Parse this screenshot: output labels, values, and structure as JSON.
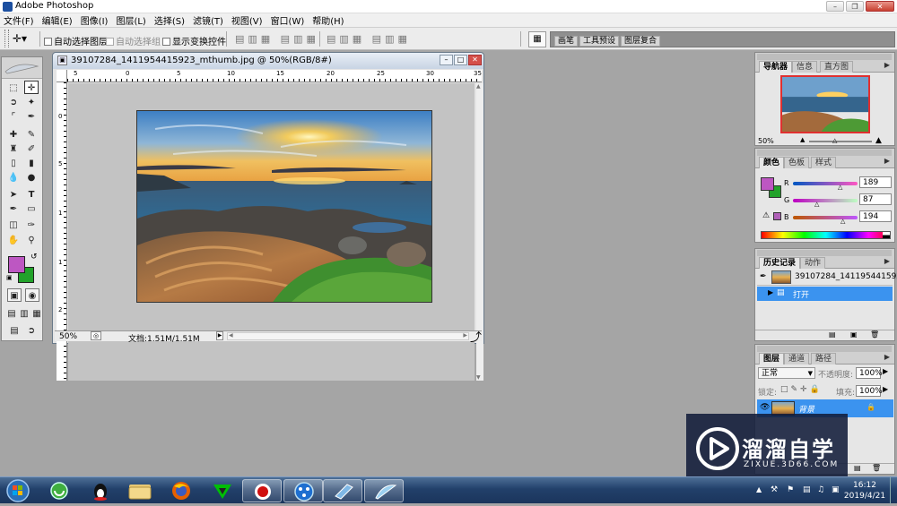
{
  "app": {
    "title": "Adobe Photoshop"
  },
  "menu": [
    "文件(F)",
    "编辑(E)",
    "图像(I)",
    "图层(L)",
    "选择(S)",
    "滤镜(T)",
    "视图(V)",
    "窗口(W)",
    "帮助(H)"
  ],
  "options": {
    "auto_select_layer": "自动选择图层",
    "auto_select_group": "自动选择组",
    "show_transform": "显示变换控件",
    "well_tabs": [
      "画笔",
      "工具预设",
      "图层复合"
    ]
  },
  "document": {
    "title": "39107284_1411954415923_mthumb.jpg @ 50%(RGB/8#)",
    "zoom": "50%",
    "doc_size": "文档:1.51M/1.51M",
    "ruler_h": [
      "5",
      "0",
      "5",
      "10",
      "15",
      "20",
      "25",
      "30",
      "35"
    ],
    "ruler_v": [
      "0",
      "5",
      "1",
      "1",
      "2"
    ]
  },
  "navigator": {
    "tabs": [
      "导航器",
      "信息",
      "直方图"
    ],
    "zoom": "50%"
  },
  "color": {
    "tabs": [
      "颜色",
      "色板",
      "样式"
    ],
    "channels": [
      {
        "label": "R",
        "value": "189"
      },
      {
        "label": "G",
        "value": "87"
      },
      {
        "label": "B",
        "value": "194"
      }
    ],
    "foreground": "#bd57c2",
    "background": "#22a22a"
  },
  "history": {
    "tabs": [
      "历史记录",
      "动作"
    ],
    "snapshot": "39107284_1411954415923_mthu...",
    "items": [
      "打开"
    ]
  },
  "layers": {
    "tabs": [
      "图层",
      "通道",
      "路径"
    ],
    "blend_mode": "正常",
    "opacity_label": "不透明度:",
    "opacity": "100%",
    "lock_label": "锁定:",
    "fill_label": "填充:",
    "fill": "100%",
    "items": [
      "背景"
    ]
  },
  "watermark": {
    "brand": "溜溜自学",
    "url": "ZIXUE.3D66.COM"
  },
  "taskbar": {
    "time": "16:12",
    "date": "2019/4/21"
  },
  "colors": {
    "accent": "#3b93ef",
    "fg": "#bd57c2",
    "bg": "#22a22a"
  }
}
